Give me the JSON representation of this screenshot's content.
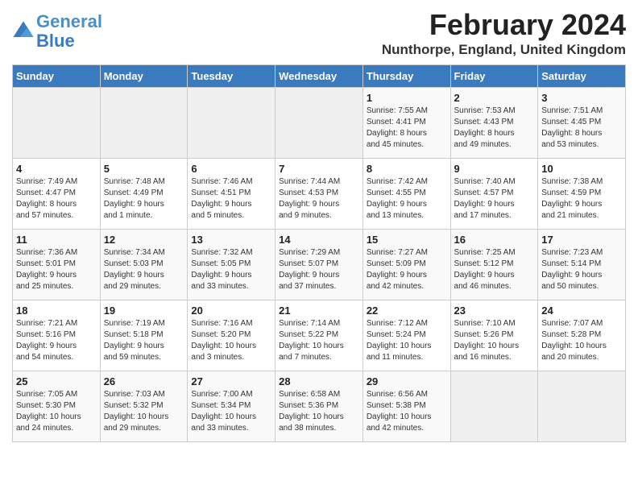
{
  "logo": {
    "line1": "General",
    "line2": "Blue"
  },
  "title": "February 2024",
  "location": "Nunthorpe, England, United Kingdom",
  "weekdays": [
    "Sunday",
    "Monday",
    "Tuesday",
    "Wednesday",
    "Thursday",
    "Friday",
    "Saturday"
  ],
  "weeks": [
    [
      {
        "day": "",
        "info": ""
      },
      {
        "day": "",
        "info": ""
      },
      {
        "day": "",
        "info": ""
      },
      {
        "day": "",
        "info": ""
      },
      {
        "day": "1",
        "info": "Sunrise: 7:55 AM\nSunset: 4:41 PM\nDaylight: 8 hours\nand 45 minutes."
      },
      {
        "day": "2",
        "info": "Sunrise: 7:53 AM\nSunset: 4:43 PM\nDaylight: 8 hours\nand 49 minutes."
      },
      {
        "day": "3",
        "info": "Sunrise: 7:51 AM\nSunset: 4:45 PM\nDaylight: 8 hours\nand 53 minutes."
      }
    ],
    [
      {
        "day": "4",
        "info": "Sunrise: 7:49 AM\nSunset: 4:47 PM\nDaylight: 8 hours\nand 57 minutes."
      },
      {
        "day": "5",
        "info": "Sunrise: 7:48 AM\nSunset: 4:49 PM\nDaylight: 9 hours\nand 1 minute."
      },
      {
        "day": "6",
        "info": "Sunrise: 7:46 AM\nSunset: 4:51 PM\nDaylight: 9 hours\nand 5 minutes."
      },
      {
        "day": "7",
        "info": "Sunrise: 7:44 AM\nSunset: 4:53 PM\nDaylight: 9 hours\nand 9 minutes."
      },
      {
        "day": "8",
        "info": "Sunrise: 7:42 AM\nSunset: 4:55 PM\nDaylight: 9 hours\nand 13 minutes."
      },
      {
        "day": "9",
        "info": "Sunrise: 7:40 AM\nSunset: 4:57 PM\nDaylight: 9 hours\nand 17 minutes."
      },
      {
        "day": "10",
        "info": "Sunrise: 7:38 AM\nSunset: 4:59 PM\nDaylight: 9 hours\nand 21 minutes."
      }
    ],
    [
      {
        "day": "11",
        "info": "Sunrise: 7:36 AM\nSunset: 5:01 PM\nDaylight: 9 hours\nand 25 minutes."
      },
      {
        "day": "12",
        "info": "Sunrise: 7:34 AM\nSunset: 5:03 PM\nDaylight: 9 hours\nand 29 minutes."
      },
      {
        "day": "13",
        "info": "Sunrise: 7:32 AM\nSunset: 5:05 PM\nDaylight: 9 hours\nand 33 minutes."
      },
      {
        "day": "14",
        "info": "Sunrise: 7:29 AM\nSunset: 5:07 PM\nDaylight: 9 hours\nand 37 minutes."
      },
      {
        "day": "15",
        "info": "Sunrise: 7:27 AM\nSunset: 5:09 PM\nDaylight: 9 hours\nand 42 minutes."
      },
      {
        "day": "16",
        "info": "Sunrise: 7:25 AM\nSunset: 5:12 PM\nDaylight: 9 hours\nand 46 minutes."
      },
      {
        "day": "17",
        "info": "Sunrise: 7:23 AM\nSunset: 5:14 PM\nDaylight: 9 hours\nand 50 minutes."
      }
    ],
    [
      {
        "day": "18",
        "info": "Sunrise: 7:21 AM\nSunset: 5:16 PM\nDaylight: 9 hours\nand 54 minutes."
      },
      {
        "day": "19",
        "info": "Sunrise: 7:19 AM\nSunset: 5:18 PM\nDaylight: 9 hours\nand 59 minutes."
      },
      {
        "day": "20",
        "info": "Sunrise: 7:16 AM\nSunset: 5:20 PM\nDaylight: 10 hours\nand 3 minutes."
      },
      {
        "day": "21",
        "info": "Sunrise: 7:14 AM\nSunset: 5:22 PM\nDaylight: 10 hours\nand 7 minutes."
      },
      {
        "day": "22",
        "info": "Sunrise: 7:12 AM\nSunset: 5:24 PM\nDaylight: 10 hours\nand 11 minutes."
      },
      {
        "day": "23",
        "info": "Sunrise: 7:10 AM\nSunset: 5:26 PM\nDaylight: 10 hours\nand 16 minutes."
      },
      {
        "day": "24",
        "info": "Sunrise: 7:07 AM\nSunset: 5:28 PM\nDaylight: 10 hours\nand 20 minutes."
      }
    ],
    [
      {
        "day": "25",
        "info": "Sunrise: 7:05 AM\nSunset: 5:30 PM\nDaylight: 10 hours\nand 24 minutes."
      },
      {
        "day": "26",
        "info": "Sunrise: 7:03 AM\nSunset: 5:32 PM\nDaylight: 10 hours\nand 29 minutes."
      },
      {
        "day": "27",
        "info": "Sunrise: 7:00 AM\nSunset: 5:34 PM\nDaylight: 10 hours\nand 33 minutes."
      },
      {
        "day": "28",
        "info": "Sunrise: 6:58 AM\nSunset: 5:36 PM\nDaylight: 10 hours\nand 38 minutes."
      },
      {
        "day": "29",
        "info": "Sunrise: 6:56 AM\nSunset: 5:38 PM\nDaylight: 10 hours\nand 42 minutes."
      },
      {
        "day": "",
        "info": ""
      },
      {
        "day": "",
        "info": ""
      }
    ]
  ]
}
